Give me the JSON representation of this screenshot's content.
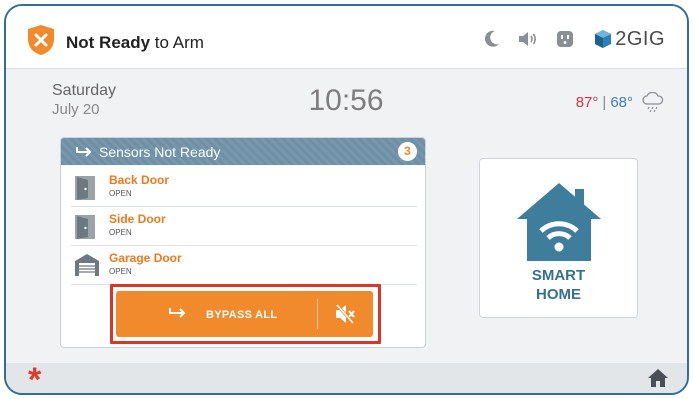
{
  "header": {
    "status_strong": "Not Ready",
    "status_rest": " to Arm",
    "brand": "2GIG",
    "icons": [
      "moon-icon",
      "speaker-icon",
      "outlet-icon",
      "cube-logo-icon"
    ]
  },
  "info": {
    "day": "Saturday",
    "date": "July 20",
    "time": "10:56",
    "temp_high": "87°",
    "separator": "|",
    "temp_low": "68°",
    "weather_icon": "rain-cloud-icon"
  },
  "sensors": {
    "title": "Sensors Not Ready",
    "count": "3",
    "items": [
      {
        "name": "Back Door",
        "state": "OPEN",
        "icon": "door-icon"
      },
      {
        "name": "Side Door",
        "state": "OPEN",
        "icon": "door-icon"
      },
      {
        "name": "Garage Door",
        "state": "OPEN",
        "icon": "garage-icon"
      }
    ],
    "bypass_label": "BYPASS ALL"
  },
  "smart_home": {
    "line1": "SMART",
    "line2": "HOME"
  },
  "colors": {
    "accent": "#f08a2c",
    "frame": "#2f6f93",
    "highlight": "#d9362b",
    "temp_high": "#d0344a",
    "temp_low": "#3c7fc0",
    "tile_text": "#36708f"
  }
}
